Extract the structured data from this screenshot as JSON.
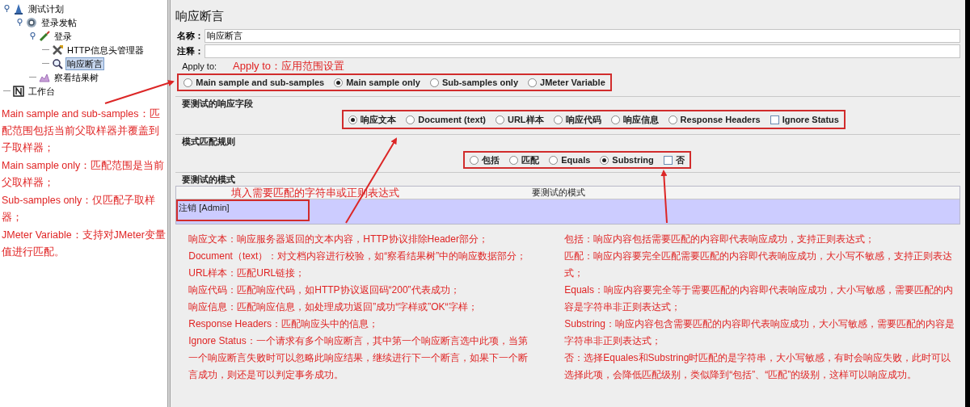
{
  "tree": [
    {
      "label": "测试计划",
      "kind": "plan",
      "selected": false,
      "children": [
        {
          "label": "登录发帖",
          "kind": "thread-group",
          "selected": false,
          "children": [
            {
              "label": "登录",
              "kind": "sampler",
              "selected": false,
              "children": [
                {
                  "label": "HTTP信息头管理器",
                  "kind": "config",
                  "selected": false
                },
                {
                  "label": "响应断言",
                  "kind": "assertion",
                  "selected": true
                }
              ]
            },
            {
              "label": "察看结果树",
              "kind": "listener",
              "selected": false
            }
          ]
        }
      ]
    },
    {
      "label": "工作台",
      "kind": "workbench",
      "selected": false
    }
  ],
  "left_notes": [
    "Main sample and sub-samples：匹配范围包括当前父取样器并覆盖到子取样器；",
    "Main sample only：匹配范围是当前父取样器；",
    "Sub-samples only：仅匹配子取样器；",
    "JMeter Variable：支持对JMeter变量值进行匹配。"
  ],
  "panel": {
    "title": "响应断言",
    "name_field": {
      "label": "名称：",
      "value": "响应断言"
    },
    "comment_field": {
      "label": "注释："
    },
    "apply_to": {
      "label": "Apply to:",
      "annotation": "Apply to：应用范围设置",
      "options": [
        {
          "kind": "radio",
          "label": "Main sample and sub-samples",
          "selected": false
        },
        {
          "kind": "radio",
          "label": "Main sample only",
          "selected": true
        },
        {
          "kind": "radio",
          "label": "Sub-samples only",
          "selected": false
        },
        {
          "kind": "radio",
          "label": "JMeter Variable",
          "selected": false
        }
      ]
    },
    "response_field": {
      "title": "要测试的响应字段",
      "options": [
        {
          "kind": "radio",
          "label": "响应文本",
          "selected": true
        },
        {
          "kind": "radio",
          "label": "Document (text)",
          "selected": false
        },
        {
          "kind": "radio",
          "label": "URL样本",
          "selected": false
        },
        {
          "kind": "radio",
          "label": "响应代码",
          "selected": false
        },
        {
          "kind": "radio",
          "label": "响应信息",
          "selected": false
        },
        {
          "kind": "radio",
          "label": "Response Headers",
          "selected": false
        },
        {
          "kind": "checkbox",
          "label": "Ignore Status",
          "checked": false
        }
      ]
    },
    "pattern_rule": {
      "title": "模式匹配规则",
      "options": [
        {
          "kind": "radio",
          "label": "包括",
          "selected": false
        },
        {
          "kind": "radio",
          "label": "匹配",
          "selected": false
        },
        {
          "kind": "radio",
          "label": "Equals",
          "selected": false
        },
        {
          "kind": "radio",
          "label": "Substring",
          "selected": true
        },
        {
          "kind": "checkbox",
          "label": "否",
          "checked": false
        }
      ]
    },
    "patterns": {
      "title": "要测试的模式",
      "annotation": "填入需要匹配的字符串或正则表达式",
      "column": "要测试的模式",
      "rows": [
        "注销 [Admin]"
      ]
    },
    "notes_left": [
      "响应文本：响应服务器返回的文本内容，HTTP协议排除Header部分；",
      "Document（text）：对文档内容进行校验，如“察看结果树”中的响应数据部分；",
      "URL样本：匹配URL链接；",
      "响应代码：匹配响应代码，如HTTP协议返回码“200”代表成功；",
      "响应信息：匹配响应信息，如处理成功返回”成功“字样或”OK“字样；",
      "Response Headers：匹配响应头中的信息；",
      "Ignore Status：一个请求有多个响应断言，其中第一个响应断言选中此项，当第一个响应断言失败时可以忽略此响应结果，继续进行下一个断言，如果下一个断言成功，则还是可以判定事务成功。"
    ],
    "notes_right": [
      "包括：响应内容包括需要匹配的内容即代表响应成功，支持正则表达式；",
      "匹配：响应内容要完全匹配需要匹配的内容即代表响应成功，大小写不敏感，支持正则表达式；",
      "Equals：响应内容要完全等于需要匹配的内容即代表响应成功，大小写敏感，需要匹配的内容是字符串非正则表达式；",
      "Substring：响应内容包含需要匹配的内容即代表响应成功，大小写敏感，需要匹配的内容是字符串非正则表达式；",
      "否：选择Equales和Substring时匹配的是字符串，大小写敏感，有时会响应失败，此时可以选择此项，会降低匹配级别，类似降到“包括”、“匹配”的级别，这样可以响应成功。"
    ]
  }
}
